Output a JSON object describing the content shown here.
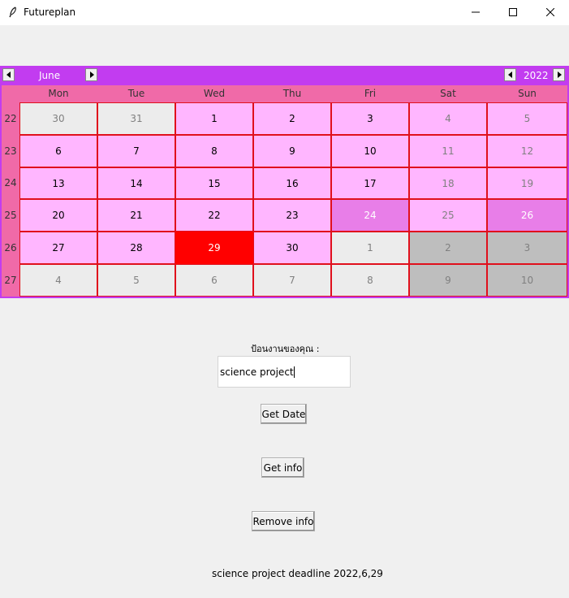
{
  "window": {
    "title": "Futureplan",
    "icon": "feather-icon"
  },
  "calendar": {
    "month": "June",
    "year": "2022",
    "weekday_headers": [
      "Mon",
      "Tue",
      "Wed",
      "Thu",
      "Fri",
      "Sat",
      "Sun"
    ],
    "week_numbers": [
      "22",
      "23",
      "24",
      "25",
      "26",
      "27"
    ],
    "weeks": [
      [
        "30",
        "31",
        "1",
        "2",
        "3",
        "4",
        "5"
      ],
      [
        "6",
        "7",
        "8",
        "9",
        "10",
        "11",
        "12"
      ],
      [
        "13",
        "14",
        "15",
        "16",
        "17",
        "18",
        "19"
      ],
      [
        "20",
        "21",
        "22",
        "23",
        "24",
        "25",
        "26"
      ],
      [
        "27",
        "28",
        "29",
        "30",
        "1",
        "2",
        "3"
      ],
      [
        "4",
        "5",
        "6",
        "7",
        "8",
        "9",
        "10"
      ]
    ],
    "highlighted_days": [
      "24",
      "26"
    ],
    "selected_day": "29",
    "colors": {
      "header": "#c23cf0",
      "weekday_band": "#f06aa8",
      "current_month_day": "#ffb6ff",
      "other_month_day": "#ececec",
      "other_month_weekend": "#bebebe",
      "highlighted_day": "#e87ee8",
      "selected_day": "#ff0000",
      "cell_border": "#e0101c"
    }
  },
  "form": {
    "entry_label": "ป้อนงานของคุณ :",
    "entry_value": "science project",
    "get_date_label": "Get Date",
    "get_info_label": "Get info",
    "remove_info_label": "Remove info"
  },
  "status": {
    "text": "science project deadline 2022,6,29"
  }
}
